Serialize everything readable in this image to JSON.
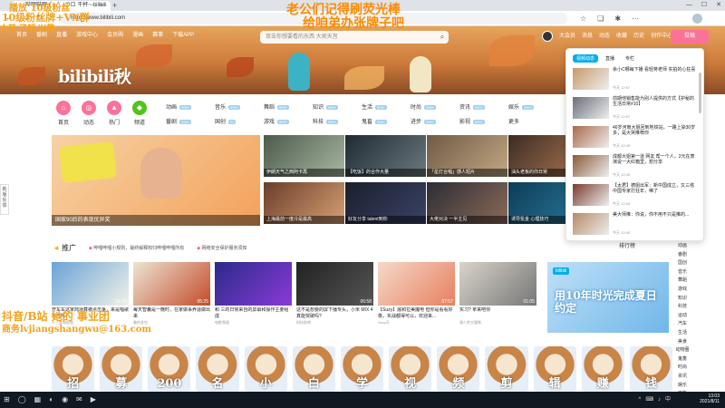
{
  "browser": {
    "tab_title": "哔哩哔哩 (゜-゜)つロ 干杯~-bilibili",
    "url": "https://www.bilibili.com",
    "close_symbol": "×",
    "newtab_symbol": "+",
    "window_controls": [
      "—",
      "☐",
      "✕"
    ]
  },
  "overlay": {
    "line1": "播放 10级粉丝 ",
    "line2": "10级粉丝牌+VX群",
    "line3": "大萌 了解 兴趣",
    "line4": "老公们记得刷荧光棒",
    "line5": "给咱弟办张牌子吧",
    "line6": "抖音/B站 她的  事业团",
    "line7": "商务lvjiangshangwu@163.com"
  },
  "topnav": [
    "首页",
    "番剧",
    "直播",
    "游戏中心",
    "会员购",
    "漫画",
    "赛事",
    "下载APP"
  ],
  "search": {
    "placeholder": "双击你想要看的东西 大闹天宫",
    "icon": "search-icon"
  },
  "usernav": [
    "大会员",
    "消息",
    "动态",
    "收藏",
    "历史",
    "创作中心"
  ],
  "upload_label": "投稿",
  "logo": "bilibili秋",
  "channels_main": [
    {
      "label": "首页",
      "color": "#fb7299",
      "icon": "home-icon"
    },
    {
      "label": "动态",
      "color": "#fb7299",
      "icon": "trend-icon"
    },
    {
      "label": "热门",
      "color": "#fb7299",
      "icon": "fire-icon"
    },
    {
      "label": "频道",
      "color": "#52c41a",
      "icon": "channel-icon"
    }
  ],
  "categories": [
    {
      "name": "动画",
      "count": "999+"
    },
    {
      "name": "音乐",
      "count": "999+"
    },
    {
      "name": "舞蹈",
      "count": "999+"
    },
    {
      "name": "知识",
      "count": "999+"
    },
    {
      "name": "生活",
      "count": "999+"
    },
    {
      "name": "时尚",
      "count": "999+"
    },
    {
      "name": "资讯",
      "count": "999+"
    },
    {
      "name": "娱乐",
      "count": "999+"
    },
    {
      "name": "番剧",
      "count": "999+"
    },
    {
      "name": "国创",
      "count": "29"
    },
    {
      "name": "游戏",
      "count": "999+"
    },
    {
      "name": "科技",
      "count": "999+"
    },
    {
      "name": "鬼畜",
      "count": "999+"
    },
    {
      "name": "进步",
      "count": "999+"
    },
    {
      "name": "影视",
      "count": "999+"
    },
    {
      "name": "更多",
      "count": ""
    }
  ],
  "carousel": {
    "caption": "国家90后的表现优异奖"
  },
  "thumbs": [
    {
      "title": "伊朗天气之西阿卡再",
      "colors": [
        "#4c5a4b",
        "#a9b6a2"
      ]
    },
    {
      "title": "【吃饭】的合作大量",
      "colors": [
        "#1f2a33",
        "#6a7a7e"
      ]
    },
    {
      "title": "「星灯合唱」感人短片",
      "colors": [
        "#6f5a46",
        "#c2a882"
      ]
    },
    {
      "title": "油头老板的你日常",
      "colors": [
        "#3a2b22",
        "#b07a55"
      ]
    },
    {
      "title": "上海最前一度冷是最高",
      "colors": [
        "#6a3d2a",
        "#d7a073"
      ]
    },
    {
      "title": "好友分享 talent到你",
      "colors": [
        "#1b1f2c",
        "#3a4266"
      ]
    },
    {
      "title": "大佬对决 一半主见",
      "colors": [
        "#2b2d33",
        "#8c6a59"
      ]
    },
    {
      "title": "诱导氪金 心理技巧",
      "colors": [
        "#0d3b54",
        "#2a7aa0"
      ]
    }
  ],
  "popup": {
    "tabs": [
      "视频动态",
      "直播",
      "专栏"
    ],
    "items": [
      {
        "title": "余小C哪每下播 看轻蒋老师 实拍的心狂喜",
        "meta": "今天 12:57",
        "color": "#c79a6a"
      },
      {
        "title": "前期他销售能为别人提供的方式【护秘的生活日常#10】",
        "meta": "今天 12:57",
        "color": "#6b6f7a"
      },
      {
        "title": "46岁河南大姐回到地铁站，一路上染30岁多，是大哭推荐你",
        "meta": "今天 12:49",
        "color": "#a96a4a"
      },
      {
        "title": "成都大姐第一道 网友 帮一个人，2元在表演说一大红箱里，想分享",
        "meta": "今天 12:49",
        "color": "#8b5a3a"
      },
      {
        "title": "【太君】德姐出军：新中国成立，又三塔中国专家打狂年，稀了",
        "meta": "今天 12:43",
        "color": "#7a3d2c"
      },
      {
        "title": "美大师推：你说，你不用不只是推的...",
        "meta": "今天 12:40",
        "color": "#b58a65"
      }
    ]
  },
  "promo": {
    "title": "推广",
    "notices": [
      "哔哩哔哩小规则，最终解释权归哔哩哔哩所有",
      "网络安全保护服务须知"
    ]
  },
  "video_cards": [
    {
      "title": "开车车这家商场算被点击争，来是唱歌自己吗",
      "up": "十三度和爸爸",
      "dur": "01:07",
      "colors": [
        "#6aa3d8",
        "#f1f1e6"
      ]
    },
    {
      "title": "每天智囊是一晚时，在家做事养适做出来",
      "up": "美的金包",
      "dur": "05:25",
      "colors": [
        "#ece4d2",
        "#c44b2a"
      ]
    },
    {
      "title": "和 三的日常来自的屏幕和操作主要组成",
      "up": "电影频道",
      "dur": "",
      "colors": [
        "#2a2a8a",
        "#8a3ad6"
      ]
    },
    {
      "title": "这不是想要的屏下播专头，小米 MIX 4 真能突破吗?",
      "up": "科技前哨",
      "dur": "06:58",
      "colors": [
        "#222",
        "#555"
      ]
    },
    {
      "title": "【Suzy】展和拉美魔电 但你是看看好像，实战都得可以，欢迎来...",
      "up": "Suzy天",
      "dur": "07:57",
      "colors": [
        "#f5d9c7",
        "#e87f60"
      ]
    },
    {
      "title": "实习? 拿来吧你",
      "up": "湖人的大猫咪",
      "dur": "01:05",
      "colors": [
        "#d9d4ca",
        "#777"
      ]
    }
  ],
  "bigpromo": {
    "title": "用10年时光完成夏日约定",
    "badge": "bilibili"
  },
  "hotlist": "排行榜",
  "rightnav": [
    "动画",
    "番剧",
    "国创",
    "音乐",
    "舞蹈",
    "游戏",
    "知识",
    "科技",
    "运动",
    "汽车",
    "生活",
    "美食",
    "动物圈",
    "鬼畜",
    "时尚",
    "资讯",
    "娱乐",
    "电影",
    "TV剧"
  ],
  "strip": [
    "招",
    "募",
    "200",
    "名",
    "小",
    "白",
    "学",
    "视",
    "频",
    "剪",
    "辑",
    "赚",
    "钱"
  ],
  "taskbar": {
    "icons": [
      "⊞",
      "◯",
      "▦",
      "◐",
      "◉",
      "✉",
      "▶"
    ],
    "tray": [
      "^",
      "⌨",
      "♪",
      "中"
    ],
    "time": "13:03",
    "date": "2021/8/11"
  }
}
